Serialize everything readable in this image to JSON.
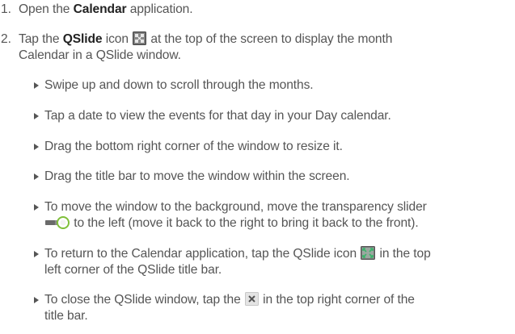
{
  "steps": [
    {
      "number": "1.",
      "pre": "Open the ",
      "bold": "Calendar",
      "post": " application."
    },
    {
      "number": "2.",
      "pre": "Tap the ",
      "bold": "QSlide",
      "mid": " icon ",
      "post_line1": " at the top of the screen to display the month",
      "post_line2": "Calendar in a QSlide window."
    }
  ],
  "substeps": {
    "scroll": "Swipe up and down to scroll through the months.",
    "tap_date": "Tap a date to view the events for that day in your Day calendar.",
    "resize": "Drag the bottom right corner of the window to resize it.",
    "move": "Drag the title bar to move the window within the screen.",
    "background_line1": "To move the window to the background, move the transparency slider",
    "background_line2": " to the left (move it back to the right to bring it back to the front).",
    "return_line1_pre": "To return to the Calendar application, tap the QSlide icon ",
    "return_line1_post": " in the top",
    "return_line2": "left corner of the QSlide title bar.",
    "close_line1_pre": "To close the QSlide window, tap the ",
    "close_line1_post": " in the top right corner of the",
    "close_line2": "title bar."
  },
  "icons": {
    "qslide": "qslide-icon",
    "slider": "transparency-slider-icon",
    "qslide_return": "qslide-return-icon",
    "close": "close-icon"
  }
}
